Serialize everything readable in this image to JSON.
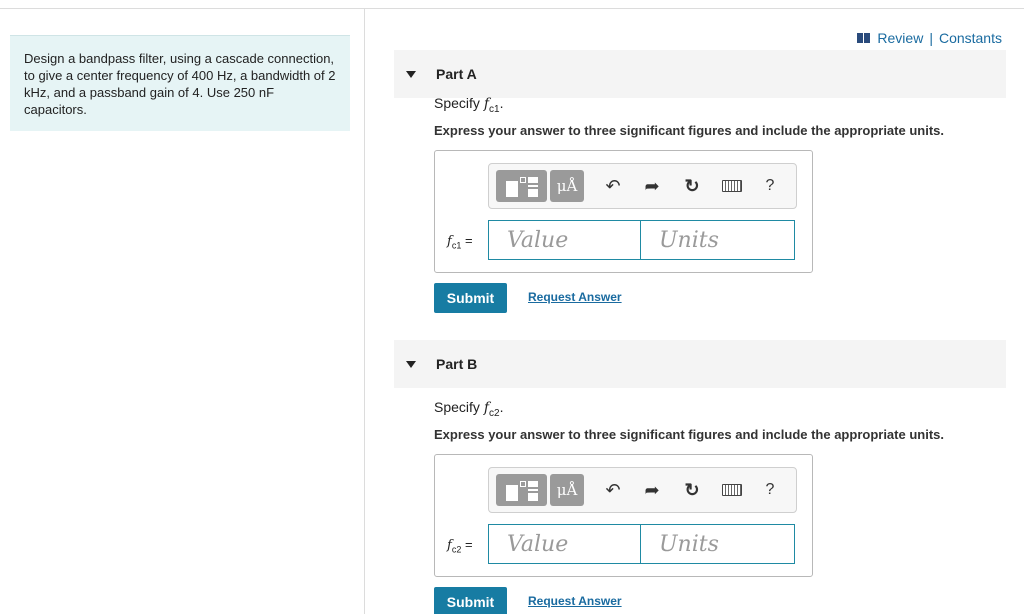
{
  "problem": {
    "text": "Design a bandpass filter, using a cascade connection, to give a center frequency of 400 Hz, a bandwidth of 2 kHz, and a passband gain of 4. Use 250 nF capacitors."
  },
  "header": {
    "review_label": "Review",
    "separator": "|",
    "constants_label": "Constants"
  },
  "parts": [
    {
      "title": "Part A",
      "specify_prefix": "Specify",
      "specify_symbol": "f",
      "specify_sub": "c1",
      "specify_suffix": ".",
      "instruction": "Express your answer to three significant figures and include the appropriate units.",
      "symbols_label": "μÅ",
      "help_label": "?",
      "var_symbol": "f",
      "var_sub": "c1",
      "var_eq": "=",
      "value_placeholder": "Value",
      "units_placeholder": "Units",
      "submit_label": "Submit",
      "request_label": "Request Answer"
    },
    {
      "title": "Part B",
      "specify_prefix": "Specify",
      "specify_symbol": "f",
      "specify_sub": "c2",
      "specify_suffix": ".",
      "instruction": "Express your answer to three significant figures and include the appropriate units.",
      "symbols_label": "μÅ",
      "help_label": "?",
      "var_symbol": "f",
      "var_sub": "c2",
      "var_eq": "=",
      "value_placeholder": "Value",
      "units_placeholder": "Units",
      "submit_label": "Submit",
      "request_label": "Request Answer"
    }
  ],
  "icons": {
    "undo": "undo-icon",
    "redo": "redo-icon",
    "reset": "reset-icon",
    "keyboard": "keyboard-icon",
    "review": "book-icon"
  },
  "colors": {
    "accent": "#177ca3",
    "link": "#1a6ba0",
    "problem_bg": "#e6f4f5",
    "input_border": "#1f8aa3"
  }
}
